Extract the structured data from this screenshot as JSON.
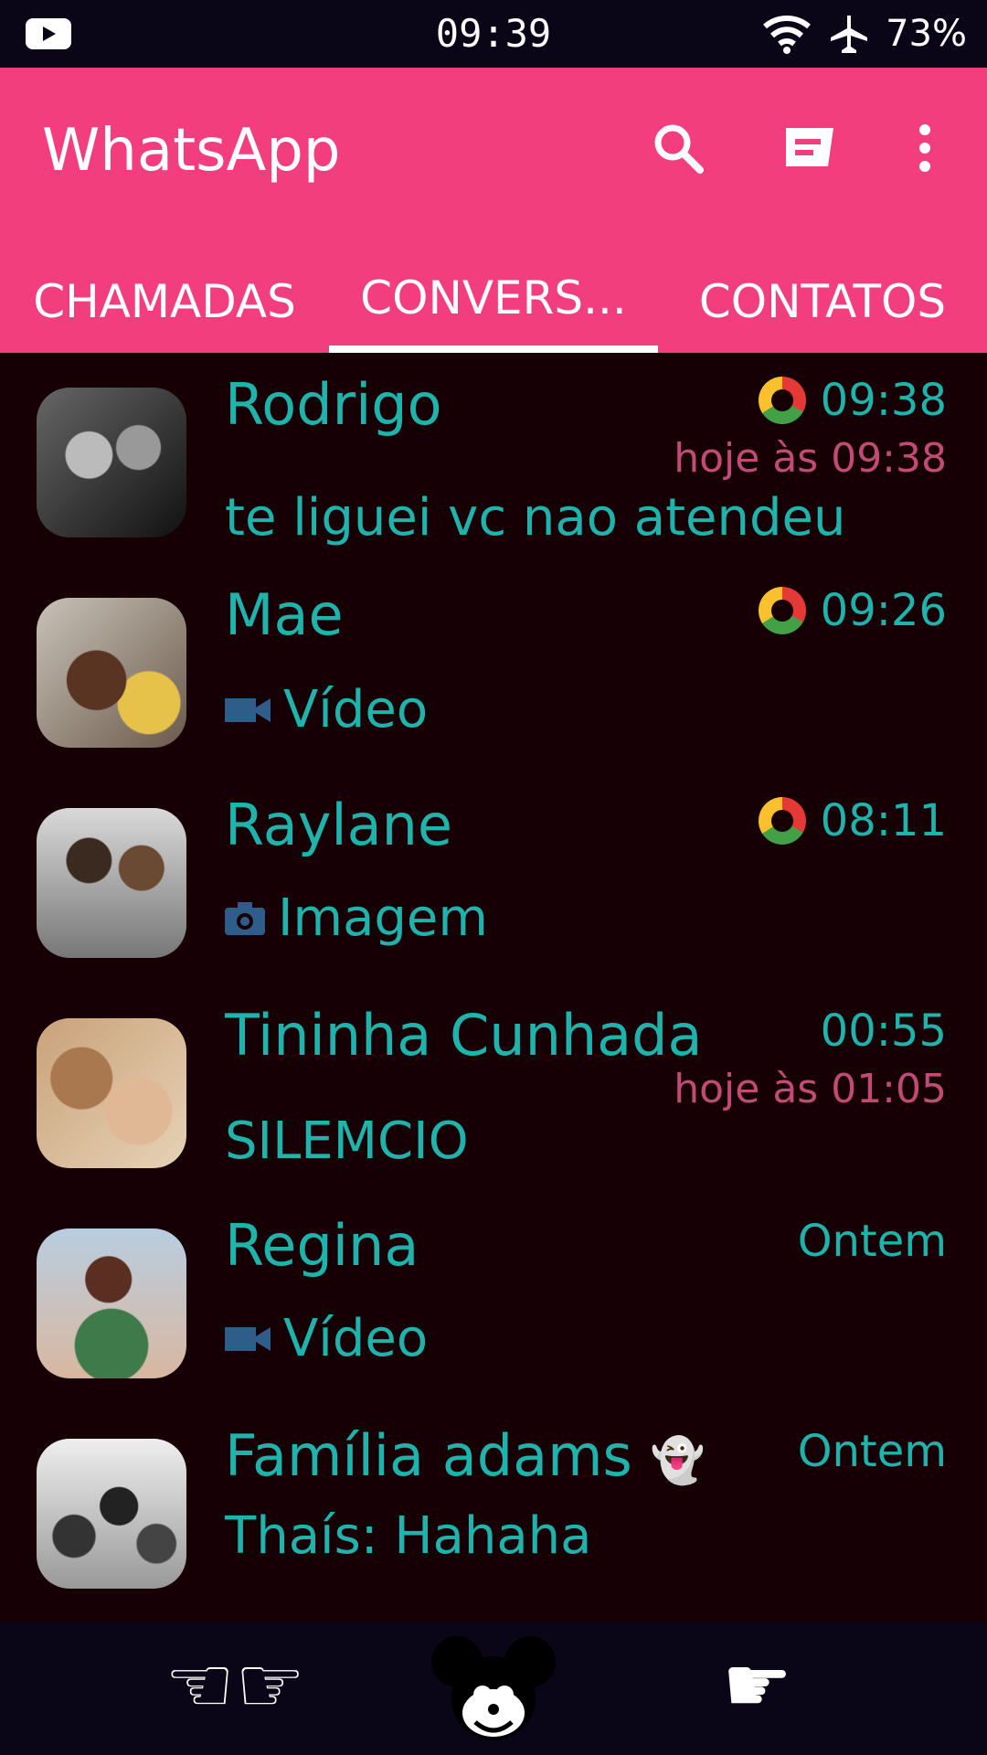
{
  "status": {
    "time": "09:39",
    "battery": "73%"
  },
  "app": {
    "title": "WhatsApp"
  },
  "tabs": {
    "calls": "CHAMADAS",
    "chats": "CONVERS...",
    "contacts": "CONTATOS"
  },
  "chats": [
    {
      "name": "Rodrigo",
      "time": "09:38",
      "sub": "hoje às 09:38",
      "msg": "te liguei vc nao atendeu"
    },
    {
      "name": "Mae",
      "time": "09:26",
      "msg": "Vídeo"
    },
    {
      "name": "Raylane",
      "time": "08:11",
      "msg": "Imagem"
    },
    {
      "name": "Tininha Cunhada",
      "time": "00:55",
      "sub": "hoje às 01:05",
      "msg": "SILEMCIO"
    },
    {
      "name": "Regina",
      "time": "Ontem",
      "msg": "Vídeo"
    },
    {
      "name": "Família adams",
      "emoji": "👻",
      "time": "Ontem",
      "msg": "Thaís: Hahaha"
    }
  ],
  "icons": {
    "search": "search-icon",
    "compose": "message-icon",
    "more": "more-vertical-icon"
  },
  "colors": {
    "accent": "#f23e7c",
    "teal": "#1fb3ac",
    "pinkText": "#c24b76",
    "background": "#160006"
  }
}
